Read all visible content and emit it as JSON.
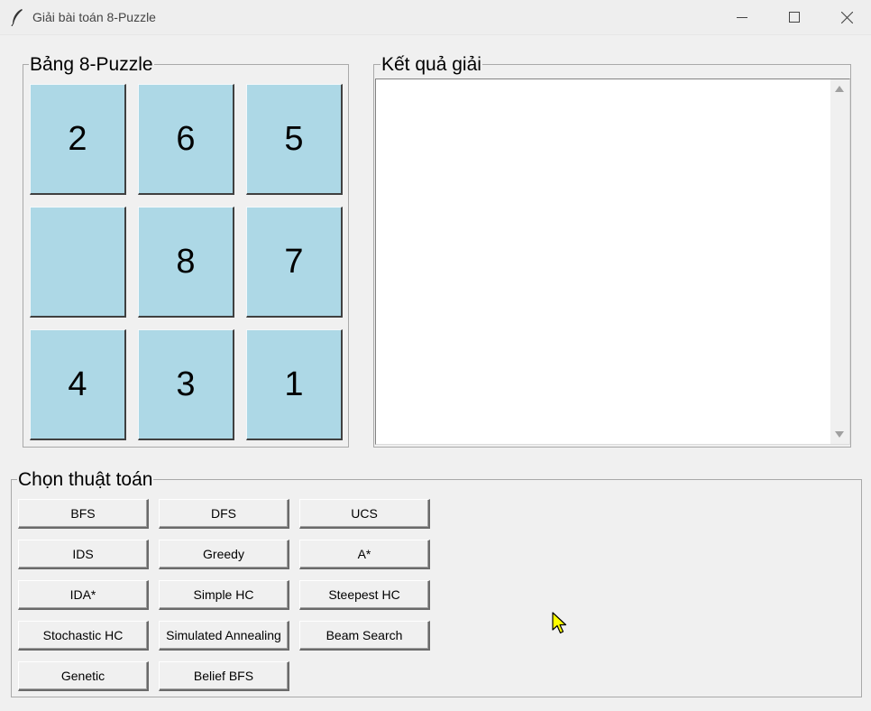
{
  "window": {
    "title": "Giải bài toán 8-Puzzle"
  },
  "board": {
    "label": "Bảng 8-Puzzle",
    "tiles": [
      "2",
      "6",
      "5",
      "",
      "8",
      "7",
      "4",
      "3",
      "1"
    ]
  },
  "result": {
    "label": "Kết quả giải",
    "text": ""
  },
  "algorithms": {
    "label": "Chọn thuật toán",
    "buttons": [
      "BFS",
      "DFS",
      "UCS",
      "IDS",
      "Greedy",
      "A*",
      "IDA*",
      "Simple HC",
      "Steepest HC",
      "Stochastic HC",
      "Simulated Annealing",
      "Beam Search",
      "Genetic",
      "Belief BFS"
    ]
  },
  "colors": {
    "tile": "#add8e6",
    "background": "#f0f0f0",
    "cursor": "#ffff00"
  },
  "icons": {
    "app": "feather-icon",
    "minimize": "minimize-icon",
    "maximize": "maximize-icon",
    "close": "close-icon"
  }
}
